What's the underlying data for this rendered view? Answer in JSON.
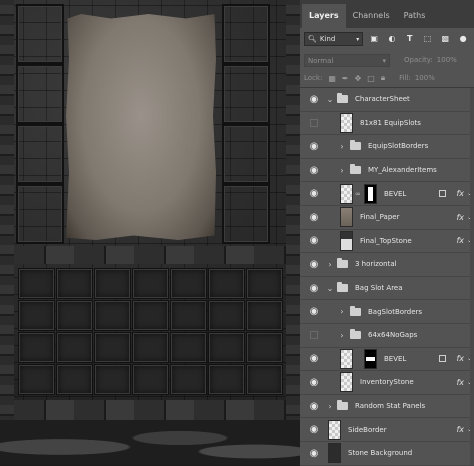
{
  "tabs": [
    {
      "label": "Layers",
      "active": true
    },
    {
      "label": "Channels",
      "active": false
    },
    {
      "label": "Paths",
      "active": false
    }
  ],
  "filter": {
    "kind_label": "Kind",
    "icons": [
      "image-filter-icon",
      "adjustment-filter-icon",
      "type-filter-icon",
      "shape-filter-icon",
      "smart-object-filter-icon",
      "filter-toggle-icon"
    ]
  },
  "blend": {
    "mode": "Normal",
    "opacity_label": "Opacity:",
    "opacity_value": "100%"
  },
  "lock": {
    "label": "Lock:",
    "fill_label": "Fill:",
    "fill_value": "100%"
  },
  "layers": [
    {
      "name": "CharacterSheet",
      "type": "group",
      "expanded": true,
      "visible": true
    },
    {
      "name": "81x81 EquipSlots",
      "type": "layer",
      "visible": false
    },
    {
      "name": "EquipSlotBorders",
      "type": "group",
      "expanded": false,
      "visible": true
    },
    {
      "name": "MY_AlexanderItems",
      "type": "group",
      "expanded": false,
      "visible": true
    },
    {
      "name": "BEVEL",
      "type": "layer",
      "visible": true,
      "fx": "fx"
    },
    {
      "name": "Final_Paper",
      "type": "layer",
      "visible": true,
      "fx": "fx"
    },
    {
      "name": "Final_TopStone",
      "type": "layer",
      "visible": true,
      "fx": "fx"
    },
    {
      "name": "3 horizontal",
      "type": "group",
      "expanded": false,
      "visible": true
    },
    {
      "name": "Bag Slot Area",
      "type": "group",
      "expanded": true,
      "visible": true
    },
    {
      "name": "BagSlotBorders",
      "type": "group",
      "expanded": false,
      "visible": true
    },
    {
      "name": "64x64NoGaps",
      "type": "group",
      "expanded": false,
      "visible": false
    },
    {
      "name": "BEVEL",
      "type": "layer",
      "visible": true,
      "fx": "fx"
    },
    {
      "name": "InventoryStone",
      "type": "layer",
      "visible": true,
      "fx": "fx"
    },
    {
      "name": "Random Stat Panels",
      "type": "group",
      "expanded": false,
      "visible": true
    },
    {
      "name": "SideBorder",
      "type": "layer",
      "visible": true,
      "fx": "fx"
    },
    {
      "name": "Stone Background",
      "type": "layer",
      "visible": true
    }
  ]
}
